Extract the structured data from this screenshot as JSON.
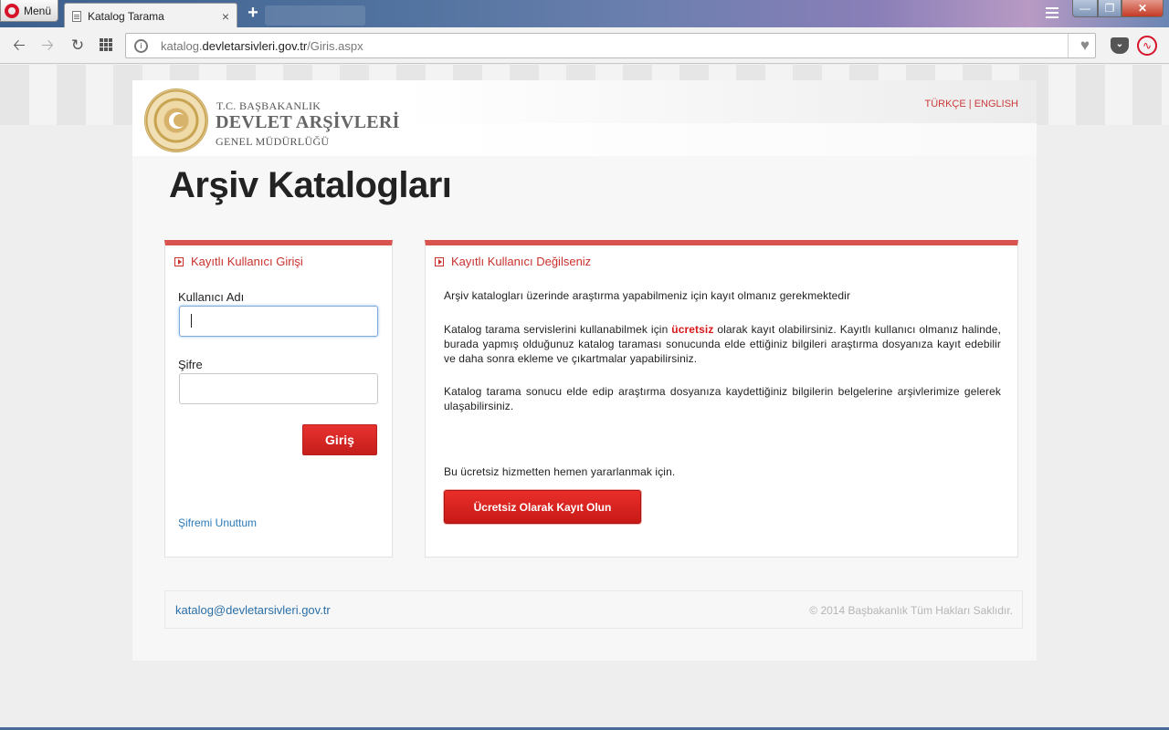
{
  "browser": {
    "menu_label": "Menü",
    "tab_title": "Katalog Tarama",
    "tab_close": "×",
    "new_tab": "+",
    "url_prefix": "katalog.",
    "url_domain": "devletarsivleri.gov.tr",
    "url_path": "/Giris.aspx",
    "icons": [
      "opera-menu-icon",
      "document-icon",
      "close-icon",
      "plus-icon",
      "tab-menu-icon",
      "back-icon",
      "forward-icon",
      "reload-icon",
      "speed-dial-icon",
      "site-info-icon",
      "heart-icon",
      "pocket-icon",
      "pulse-icon"
    ]
  },
  "header": {
    "org_line1": "T.C. BAŞBAKANLIK",
    "org_line2": "DEVLET ARŞİVLERİ",
    "org_line3": "GENEL MÜDÜRLÜĞÜ",
    "lang_tr": "TÜRKÇE",
    "lang_sep": " | ",
    "lang_en": "ENGLISH"
  },
  "page": {
    "title": "Arşiv Katalogları"
  },
  "login": {
    "heading": "Kayıtlı Kullanıcı Girişi",
    "username_label": "Kullanıcı Adı",
    "username_value": "",
    "password_label": "Şifre",
    "password_value": "",
    "submit_label": "Giriş",
    "forgot_label": "Şifremi Unuttum"
  },
  "register": {
    "heading": "Kayıtlı Kullanıcı Değilseniz",
    "para1": "Arşiv katalogları üzerinde araştırma yapabilmeniz için kayıt olmanız gerekmektedir",
    "para2_before": "Katalog tarama servislerini kullanabilmek için ",
    "para2_highlight": "ücretsiz",
    "para2_after": " olarak kayıt olabilirsiniz. Kayıtlı kullanıcı olmanız halinde, burada yapmış olduğunuz katalog taraması sonucunda elde ettiğiniz bilgileri araştırma dosyanıza kayıt edebilir ve daha sonra ekleme ve çıkartmalar yapabilirsiniz.",
    "para3": "Katalog tarama sonucu elde edip araştırma dosyanıza kaydettiğiniz bilgilerin belgelerine arşivlerimize gelerek ulaşabilirsiniz.",
    "cta_text": "Bu ücretsiz hizmetten hemen yararlanmak için.",
    "button_label": "Ücretsiz Olarak Kayıt Olun"
  },
  "footer": {
    "email": "katalog@devletarsivleri.gov.tr",
    "copyright": "© 2014 Başbakanlık Tüm Hakları Saklıdır."
  },
  "colors": {
    "accent_red": "#d9534f",
    "button_red": "#d6191c",
    "link_blue": "#2a7ab8"
  }
}
